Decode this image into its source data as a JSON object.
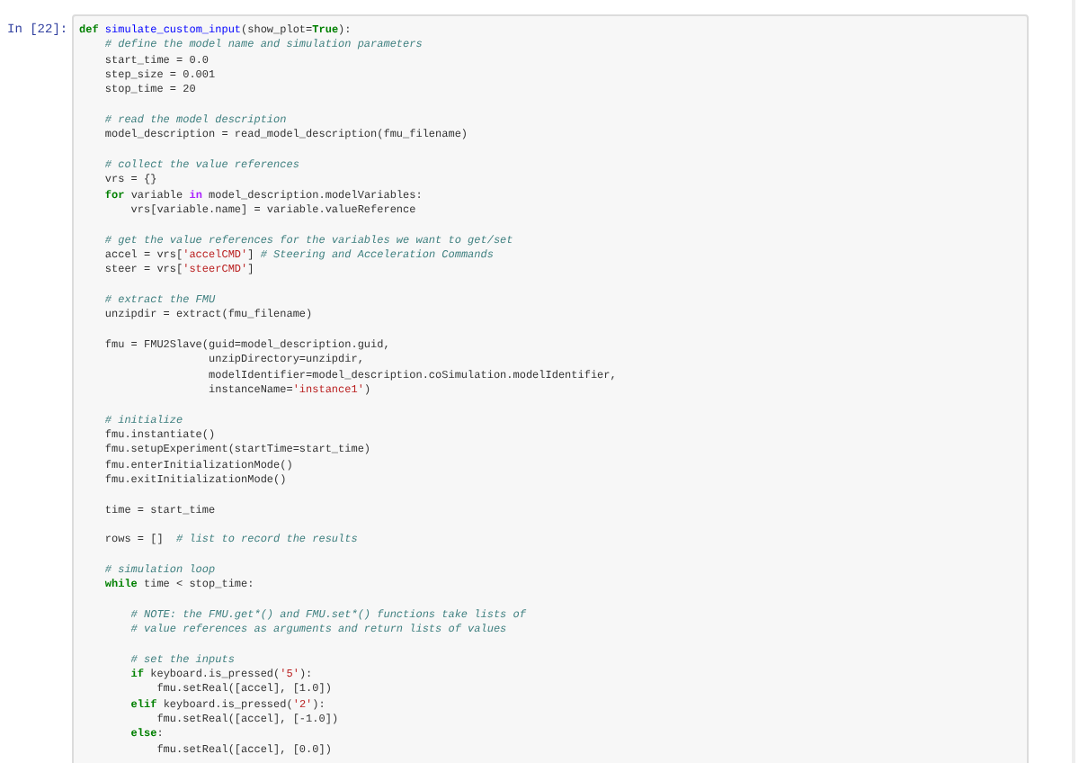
{
  "cell": {
    "prompt": "In [22]:",
    "lines": [
      {
        "kind": "code",
        "segments": [
          {
            "kind": "keyword",
            "text": "def"
          },
          {
            "kind": "function",
            "text": " simulate_custom_input"
          },
          {
            "kind": "plain",
            "text": "(show_plot="
          },
          {
            "kind": "keyword",
            "text": "True"
          },
          {
            "kind": "plain",
            "text": "):"
          }
        ]
      },
      {
        "kind": "code",
        "segments": [
          {
            "kind": "comment",
            "text": "    # define the model name and simulation parameters"
          }
        ]
      },
      {
        "kind": "code",
        "segments": [
          {
            "kind": "plain",
            "text": "    start_time = "
          },
          {
            "kind": "number",
            "text": "0.0"
          }
        ]
      },
      {
        "kind": "code",
        "segments": [
          {
            "kind": "plain",
            "text": "    step_size = "
          },
          {
            "kind": "number",
            "text": "0.001"
          }
        ]
      },
      {
        "kind": "code",
        "segments": [
          {
            "kind": "plain",
            "text": "    stop_time = "
          },
          {
            "kind": "number",
            "text": "20"
          }
        ]
      },
      {
        "kind": "blank"
      },
      {
        "kind": "code",
        "segments": [
          {
            "kind": "comment",
            "text": "    # read the model description"
          }
        ]
      },
      {
        "kind": "code",
        "segments": [
          {
            "kind": "plain",
            "text": "    model_description = read_model_description(fmu_filename)"
          }
        ]
      },
      {
        "kind": "blank"
      },
      {
        "kind": "code",
        "segments": [
          {
            "kind": "comment",
            "text": "    # collect the value references"
          }
        ]
      },
      {
        "kind": "code",
        "segments": [
          {
            "kind": "plain",
            "text": "    vrs = {}"
          }
        ]
      },
      {
        "kind": "code",
        "segments": [
          {
            "kind": "keyword",
            "text": "    for"
          },
          {
            "kind": "plain",
            "text": " variable "
          },
          {
            "kind": "operator",
            "text": "in"
          },
          {
            "kind": "plain",
            "text": " model_description.modelVariables:"
          }
        ]
      },
      {
        "kind": "code",
        "segments": [
          {
            "kind": "plain",
            "text": "        vrs[variable.name] = variable.valueReference"
          }
        ]
      },
      {
        "kind": "blank"
      },
      {
        "kind": "code",
        "segments": [
          {
            "kind": "comment",
            "text": "    # get the value references for the variables we want to get/set"
          }
        ]
      },
      {
        "kind": "code",
        "segments": [
          {
            "kind": "plain",
            "text": "    accel = vrs["
          },
          {
            "kind": "string",
            "text": "'accelCMD'"
          },
          {
            "kind": "plain",
            "text": "]"
          },
          {
            "kind": "comment",
            "text": " # Steering and Acceleration Commands"
          }
        ]
      },
      {
        "kind": "code",
        "segments": [
          {
            "kind": "plain",
            "text": "    steer = vrs["
          },
          {
            "kind": "string",
            "text": "'steerCMD'"
          },
          {
            "kind": "plain",
            "text": "]"
          }
        ]
      },
      {
        "kind": "blank"
      },
      {
        "kind": "code",
        "segments": [
          {
            "kind": "comment",
            "text": "    # extract the FMU"
          }
        ]
      },
      {
        "kind": "code",
        "segments": [
          {
            "kind": "plain",
            "text": "    unzipdir = extract(fmu_filename)"
          }
        ]
      },
      {
        "kind": "blank"
      },
      {
        "kind": "code",
        "segments": [
          {
            "kind": "plain",
            "text": "    fmu = FMU2Slave(guid=model_description.guid,"
          }
        ]
      },
      {
        "kind": "code",
        "segments": [
          {
            "kind": "plain",
            "text": "                    unzipDirectory=unzipdir,"
          }
        ]
      },
      {
        "kind": "code",
        "segments": [
          {
            "kind": "plain",
            "text": "                    modelIdentifier=model_description.coSimulation.modelIdentifier,"
          }
        ]
      },
      {
        "kind": "code",
        "segments": [
          {
            "kind": "plain",
            "text": "                    instanceName="
          },
          {
            "kind": "string",
            "text": "'instance1'"
          },
          {
            "kind": "plain",
            "text": ")"
          }
        ]
      },
      {
        "kind": "blank"
      },
      {
        "kind": "code",
        "segments": [
          {
            "kind": "comment",
            "text": "    # initialize"
          }
        ]
      },
      {
        "kind": "code",
        "segments": [
          {
            "kind": "plain",
            "text": "    fmu.instantiate()"
          }
        ]
      },
      {
        "kind": "code",
        "segments": [
          {
            "kind": "plain",
            "text": "    fmu.setupExperiment(startTime=start_time)"
          }
        ]
      },
      {
        "kind": "code",
        "segments": [
          {
            "kind": "plain",
            "text": "    fmu.enterInitializationMode()"
          }
        ]
      },
      {
        "kind": "code",
        "segments": [
          {
            "kind": "plain",
            "text": "    fmu.exitInitializationMode()"
          }
        ]
      },
      {
        "kind": "blank"
      },
      {
        "kind": "code",
        "segments": [
          {
            "kind": "plain",
            "text": "    time = start_time"
          }
        ]
      },
      {
        "kind": "blank"
      },
      {
        "kind": "code",
        "segments": [
          {
            "kind": "plain",
            "text": "    rows = []"
          },
          {
            "kind": "comment",
            "text": "  # list to record the results"
          }
        ]
      },
      {
        "kind": "blank"
      },
      {
        "kind": "code",
        "segments": [
          {
            "kind": "comment",
            "text": "    # simulation loop"
          }
        ]
      },
      {
        "kind": "code",
        "segments": [
          {
            "kind": "keyword",
            "text": "    while"
          },
          {
            "kind": "plain",
            "text": " time < stop_time:"
          }
        ]
      },
      {
        "kind": "blank"
      },
      {
        "kind": "code",
        "segments": [
          {
            "kind": "comment",
            "text": "        # NOTE: the FMU.get*() and FMU.set*() functions take lists of"
          }
        ]
      },
      {
        "kind": "code",
        "segments": [
          {
            "kind": "comment",
            "text": "        # value references as arguments and return lists of values"
          }
        ]
      },
      {
        "kind": "blank"
      },
      {
        "kind": "code",
        "segments": [
          {
            "kind": "comment",
            "text": "        # set the inputs"
          }
        ]
      },
      {
        "kind": "code",
        "segments": [
          {
            "kind": "keyword",
            "text": "        if"
          },
          {
            "kind": "plain",
            "text": " keyboard.is_pressed("
          },
          {
            "kind": "string",
            "text": "'5'"
          },
          {
            "kind": "plain",
            "text": "):"
          }
        ]
      },
      {
        "kind": "code",
        "segments": [
          {
            "kind": "plain",
            "text": "            fmu.setReal([accel], ["
          },
          {
            "kind": "number",
            "text": "1.0"
          },
          {
            "kind": "plain",
            "text": "])"
          }
        ]
      },
      {
        "kind": "code",
        "segments": [
          {
            "kind": "keyword",
            "text": "        elif"
          },
          {
            "kind": "plain",
            "text": " keyboard.is_pressed("
          },
          {
            "kind": "string",
            "text": "'2'"
          },
          {
            "kind": "plain",
            "text": "):"
          }
        ]
      },
      {
        "kind": "code",
        "segments": [
          {
            "kind": "plain",
            "text": "            fmu.setReal([accel], [-"
          },
          {
            "kind": "number",
            "text": "1.0"
          },
          {
            "kind": "plain",
            "text": "])"
          }
        ]
      },
      {
        "kind": "code",
        "segments": [
          {
            "kind": "keyword",
            "text": "        else"
          },
          {
            "kind": "plain",
            "text": ":"
          }
        ]
      },
      {
        "kind": "code",
        "segments": [
          {
            "kind": "plain",
            "text": "            fmu.setReal([accel], ["
          },
          {
            "kind": "number",
            "text": "0.0"
          },
          {
            "kind": "plain",
            "text": "])"
          }
        ]
      }
    ]
  }
}
